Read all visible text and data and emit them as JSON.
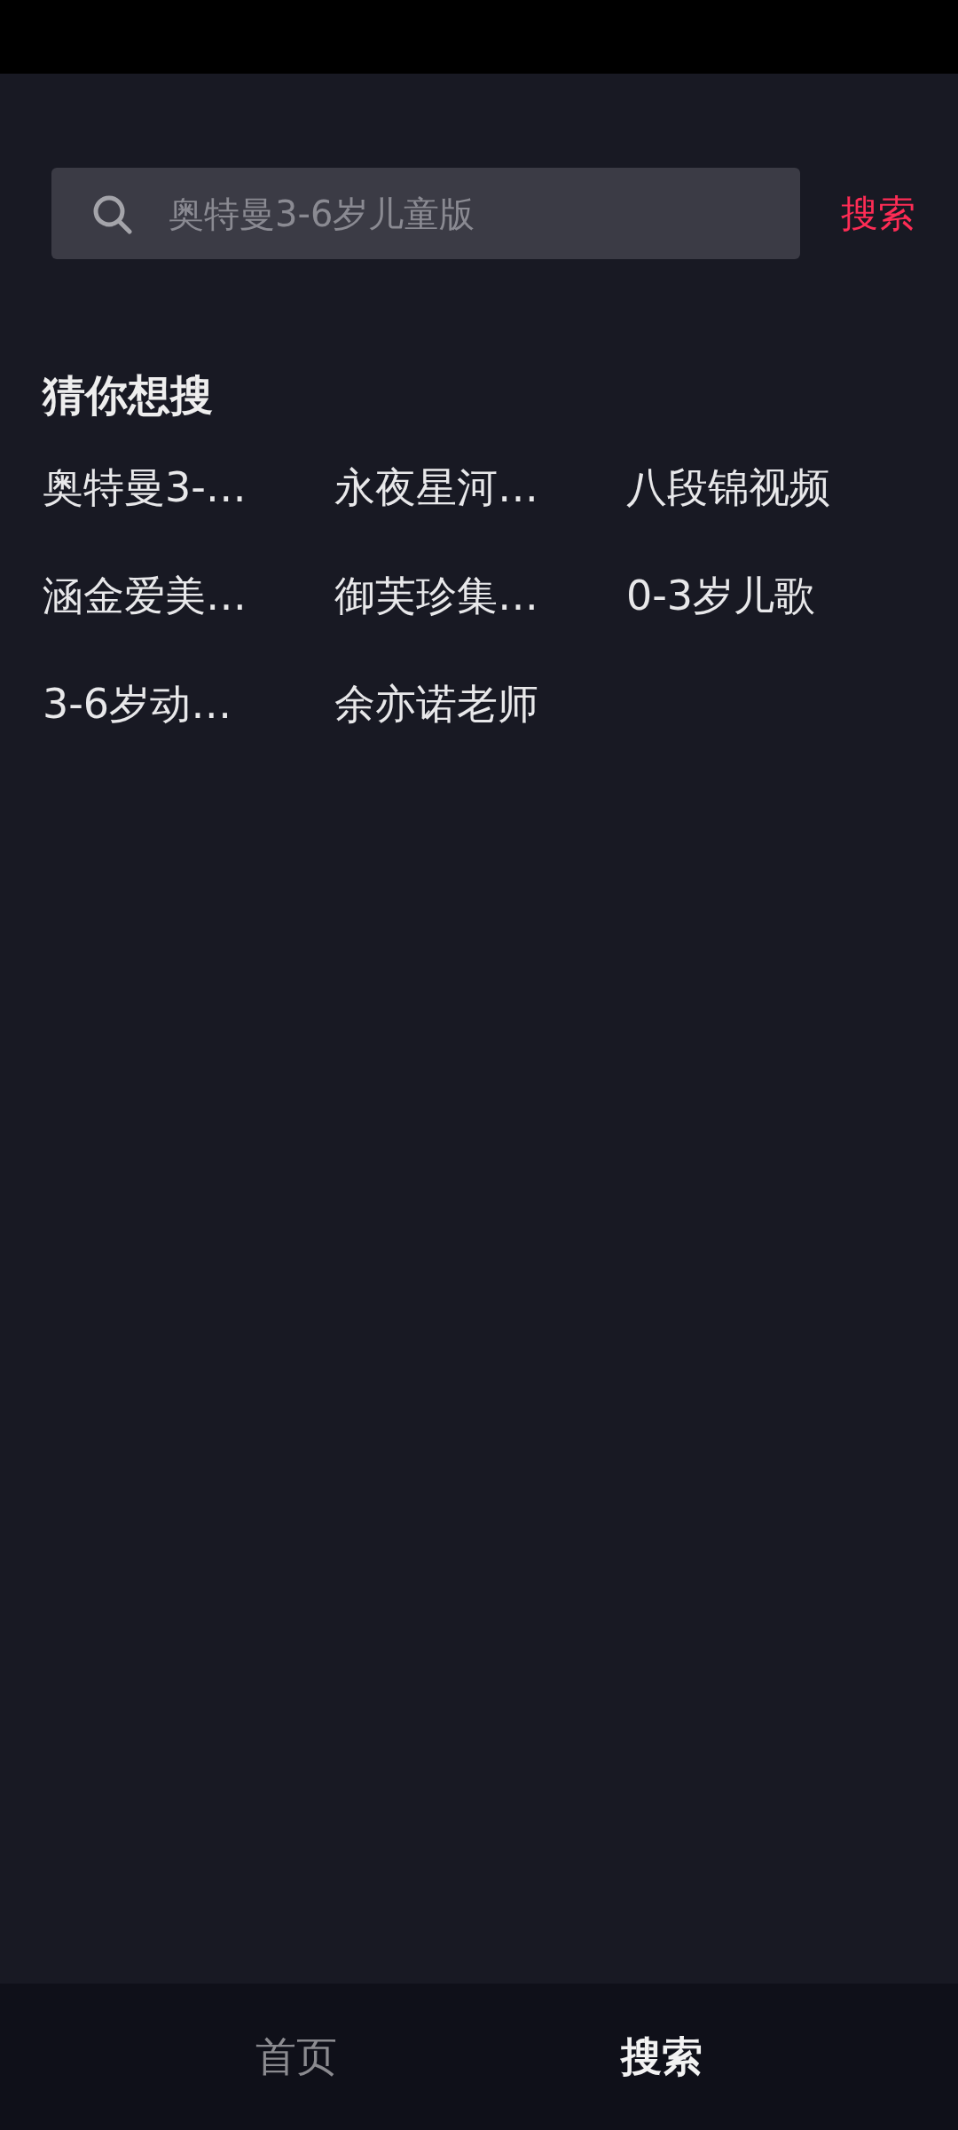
{
  "search": {
    "placeholder": "奥特曼3-6岁儿童版",
    "button": "搜索"
  },
  "suggestions": {
    "title": "猜你想搜",
    "items": [
      "奥特曼3-…",
      "永夜星河…",
      "八段锦视频",
      "涵金爱美…",
      "御芙珍集…",
      "0-3岁儿歌",
      "3-6岁动…",
      "余亦诺老师"
    ]
  },
  "tabs": [
    {
      "label": "首页",
      "selected": false
    },
    {
      "label": "搜索",
      "selected": true
    }
  ]
}
